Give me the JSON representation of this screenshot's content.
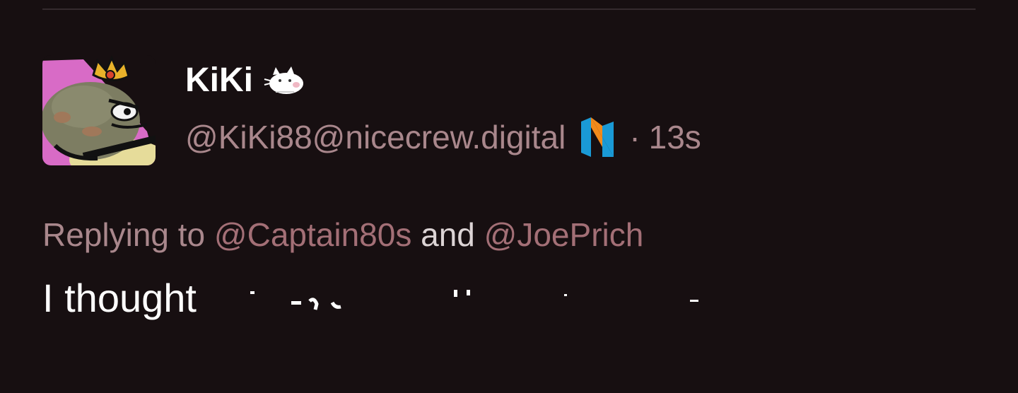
{
  "post": {
    "display_name": "KiKi",
    "display_name_emoji": "cat-emoji",
    "handle": "@KiKi88@nicecrew.digital",
    "instance_icon": "nicecrew-logo-icon",
    "separator": "·",
    "timestamp": "13s",
    "reply": {
      "prefix": "Replying to",
      "mention_1": "@Captain80s",
      "joiner": "and",
      "mention_2": "@JoePrich"
    },
    "body_text": "I thought"
  },
  "colors": {
    "background": "#170f11",
    "divider": "#352b2e",
    "muted_text": "#a9878c",
    "mention": "#a36f76",
    "primary_text": "#ffffff",
    "logo_orange": "#f28a1b",
    "logo_blue": "#1a9ad6"
  }
}
